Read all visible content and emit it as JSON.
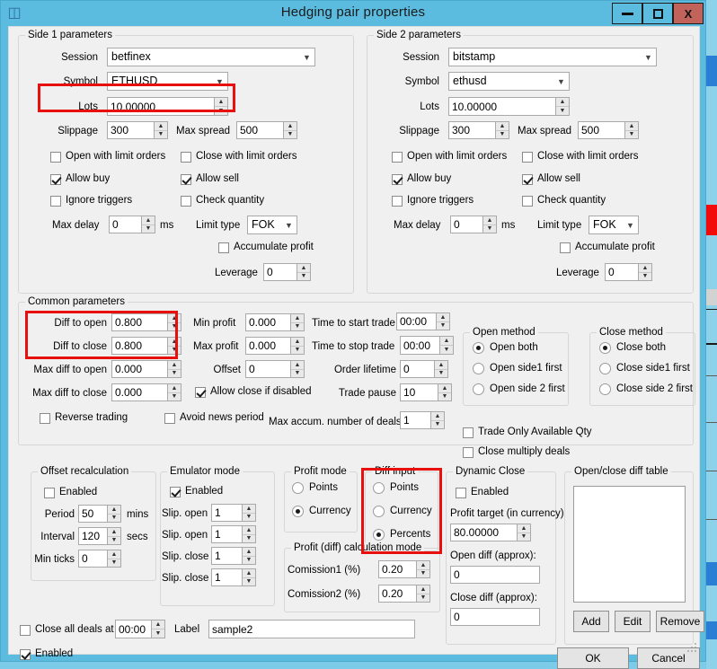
{
  "window": {
    "title": "Hedging pair properties",
    "icon": "app-cube-icon",
    "minimize_label": "",
    "maximize_label": "",
    "close_label": "X",
    "accent_color": "#5bbcdf",
    "close_button_color": "#c2635b",
    "highlight_color": "#e8100f"
  },
  "side1": {
    "title": "Side 1 parameters",
    "session_label": "Session",
    "session_value": "betfinex",
    "symbol_label": "Symbol",
    "symbol_value": "ETHUSD",
    "lots_label": "Lots",
    "lots_value": "10.00000",
    "slippage_label": "Slippage",
    "slippage_value": "300",
    "max_spread_label": "Max spread",
    "max_spread_value": "500",
    "open_with_limit_orders": "Open with limit orders",
    "close_with_limit_orders": "Close with limit orders",
    "allow_buy": "Allow buy",
    "allow_sell": "Allow sell",
    "ignore_triggers": "Ignore triggers",
    "check_quantity": "Check quantity",
    "max_delay_label": "Max delay",
    "max_delay_value": "0",
    "max_delay_units": "ms",
    "limit_type_label": "Limit type",
    "limit_type_value": "FOK",
    "accumulate_profit": "Accumulate profit",
    "leverage_label": "Leverage",
    "leverage_value": "0"
  },
  "side2": {
    "title": "Side 2 parameters",
    "session_label": "Session",
    "session_value": "bitstamp",
    "symbol_label": "Symbol",
    "symbol_value": "ethusd",
    "lots_label": "Lots",
    "lots_value": "10.00000",
    "slippage_label": "Slippage",
    "slippage_value": "300",
    "max_spread_label": "Max spread",
    "max_spread_value": "500",
    "open_with_limit_orders": "Open with limit orders",
    "close_with_limit_orders": "Close with limit orders",
    "allow_buy": "Allow buy",
    "allow_sell": "Allow sell",
    "ignore_triggers": "Ignore triggers",
    "check_quantity": "Check quantity",
    "max_delay_label": "Max delay",
    "max_delay_value": "0",
    "max_delay_units": "ms",
    "limit_type_label": "Limit type",
    "limit_type_value": "FOK",
    "accumulate_profit": "Accumulate profit",
    "leverage_label": "Leverage",
    "leverage_value": "0"
  },
  "common": {
    "title": "Common parameters",
    "diff_to_open_label": "Diff to open",
    "diff_to_open_value": "0.800",
    "diff_to_close_label": "Diff to close",
    "diff_to_close_value": "0.800",
    "max_diff_to_open_label": "Max diff to open",
    "max_diff_to_open_value": "0.000",
    "max_diff_to_close_label": "Max diff to close",
    "max_diff_to_close_value": "0.000",
    "min_profit_label": "Min profit",
    "min_profit_value": "0.000",
    "max_profit_label": "Max profit",
    "max_profit_value": "0.000",
    "offset_label": "Offset",
    "offset_value": "0",
    "allow_close_if_disabled": "Allow close if disabled",
    "reverse_trading": "Reverse trading",
    "avoid_news_period": "Avoid news period",
    "time_to_start_trade_label": "Time to start trade",
    "time_to_start_trade_value": "00:00",
    "time_to_stop_trade_label": "Time to stop trade",
    "time_to_stop_trade_value": "00:00",
    "order_lifetime_label": "Order lifetime",
    "order_lifetime_value": "0",
    "trade_pause_label": "Trade pause",
    "trade_pause_value": "10",
    "max_accum_deals_label": "Max accum. number of deals",
    "max_accum_deals_value": "1",
    "trade_only_available_qty": "Trade Only Available Qty",
    "close_multiply_deals": "Close multiply deals"
  },
  "open_method": {
    "title": "Open method",
    "options": [
      "Open both",
      "Open side1 first",
      "Open side 2 first"
    ],
    "selected": 0
  },
  "close_method": {
    "title": "Close method",
    "options": [
      "Close both",
      "Close side1 first",
      "Close side 2 first"
    ],
    "selected": 0
  },
  "offset_recalc": {
    "title": "Offset recalculation",
    "enabled_label": "Enabled",
    "period_label": "Period",
    "period_value": "50",
    "period_units": "mins",
    "interval_label": "Interval",
    "interval_value": "120",
    "interval_units": "secs",
    "min_ticks_label": "Min ticks",
    "min_ticks_value": "0"
  },
  "emulator": {
    "title": "Emulator mode",
    "enabled_label": "Enabled",
    "slip_open_1_label": "Slip. open 1",
    "slip_open_1_value": "1",
    "slip_open_2_label": "Slip. open 2",
    "slip_open_2_value": "1",
    "slip_close_1_label": "Slip. close 1",
    "slip_close_1_value": "1",
    "slip_close_2_label": "Slip. close 2",
    "slip_close_2_value": "1"
  },
  "profit_mode": {
    "title": "Profit mode",
    "options": [
      "Points",
      "Currency"
    ],
    "selected": 1
  },
  "diff_input": {
    "title": "Diff input",
    "options": [
      "Points",
      "Currency",
      "Percents"
    ],
    "selected": 2
  },
  "profit_calc": {
    "title": "Profit (diff) calculation mode",
    "comission1_label": "Comission1 (%)",
    "comission1_value": "0.20",
    "comission2_label": "Comission2 (%)",
    "comission2_value": "0.20"
  },
  "dynamic_close": {
    "title": "Dynamic Close",
    "enabled_label": "Enabled",
    "profit_target_label": "Profit target (in currency)",
    "profit_target_value": "80.00000",
    "open_diff_label": "Open diff (approx):",
    "open_diff_value": "0",
    "close_diff_label": "Close diff (approx):",
    "close_diff_value": "0"
  },
  "diff_table": {
    "title": "Open/close diff table",
    "rows": [],
    "add_label": "Add",
    "edit_label": "Edit",
    "remove_label": "Remove"
  },
  "footer": {
    "close_all_deals_label": "Close all deals at",
    "close_all_deals_time": "00:00",
    "label_caption": "Label",
    "label_value": "sample2",
    "enabled_label": "Enabled",
    "ok_label": "OK",
    "cancel_label": "Cancel"
  }
}
